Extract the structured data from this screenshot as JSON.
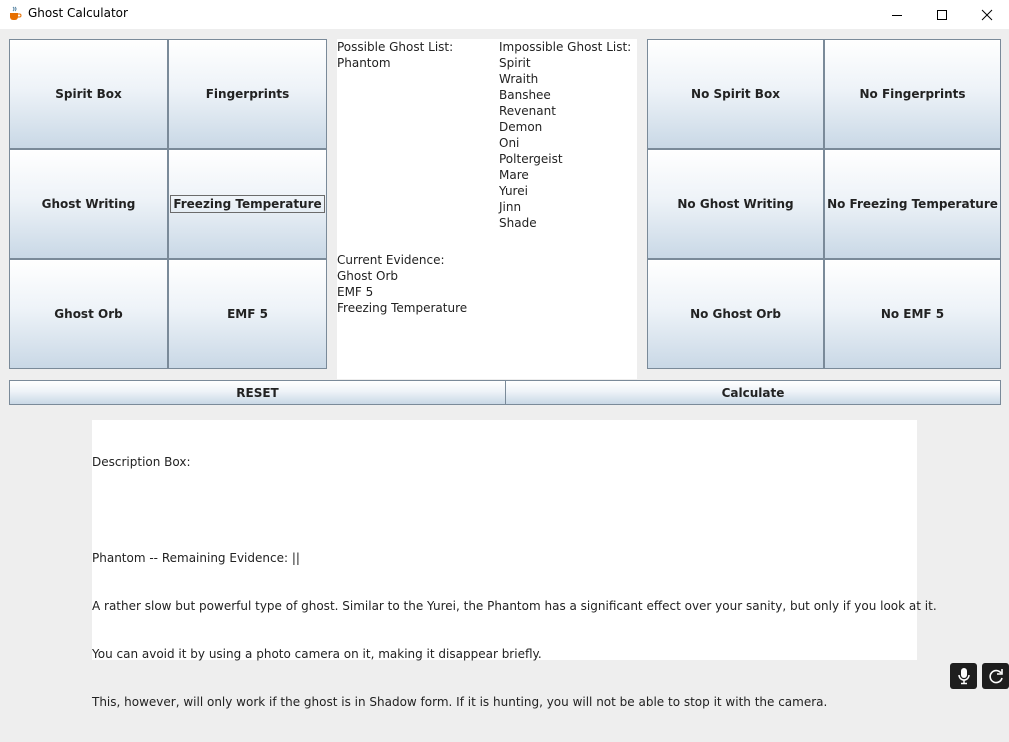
{
  "window": {
    "title": "Ghost Calculator"
  },
  "evidence_buttons": {
    "spirit_box": "Spirit Box",
    "fingerprints": "Fingerprints",
    "ghost_writing": "Ghost Writing",
    "freezing_temperature": "Freezing Temperature",
    "ghost_orb": "Ghost Orb",
    "emf5": "EMF 5"
  },
  "exclude_buttons": {
    "spirit_box": "No Spirit Box",
    "fingerprints": "No Fingerprints",
    "ghost_writing": "No Ghost Writing",
    "freezing_temperature": "No Freezing Temperature",
    "ghost_orb": "No Ghost Orb",
    "emf5": "No EMF 5"
  },
  "lists": {
    "possible_header": "Possible Ghost List:",
    "possible": [
      "Phantom"
    ],
    "impossible_header": "Impossible Ghost List:",
    "impossible": [
      "Spirit",
      "Wraith",
      "Banshee",
      "Revenant",
      "Demon",
      "Oni",
      "Poltergeist",
      "Mare",
      "Yurei",
      "Jinn",
      "Shade"
    ],
    "current_header": "Current Evidence:",
    "current": [
      "Ghost Orb",
      "EMF 5",
      "Freezing Temperature"
    ]
  },
  "actions": {
    "reset": "RESET",
    "calculate": "Calculate"
  },
  "description": {
    "header": "Description Box:",
    "lines": [
      "Phantom -- Remaining Evidence: ||",
      "A rather slow but powerful type of ghost. Similar to the Yurei, the Phantom has a significant effect over your sanity, but only if you look at it.",
      "You can avoid it by using a photo camera on it, making it disappear briefly.",
      "This, however, will only work if the ghost is in Shadow form. If it is hunting, you will not be able to stop it with the camera."
    ]
  },
  "icons": {
    "app": "java-cup-icon",
    "minimize": "minimize-icon",
    "maximize": "maximize-icon",
    "close": "close-icon",
    "mic": "microphone-icon",
    "refresh": "refresh-icon"
  },
  "colors": {
    "button_top": "#ffffff",
    "button_bottom": "#c9d8e6",
    "button_border": "#7a8a99",
    "background": "#eeeeee"
  }
}
